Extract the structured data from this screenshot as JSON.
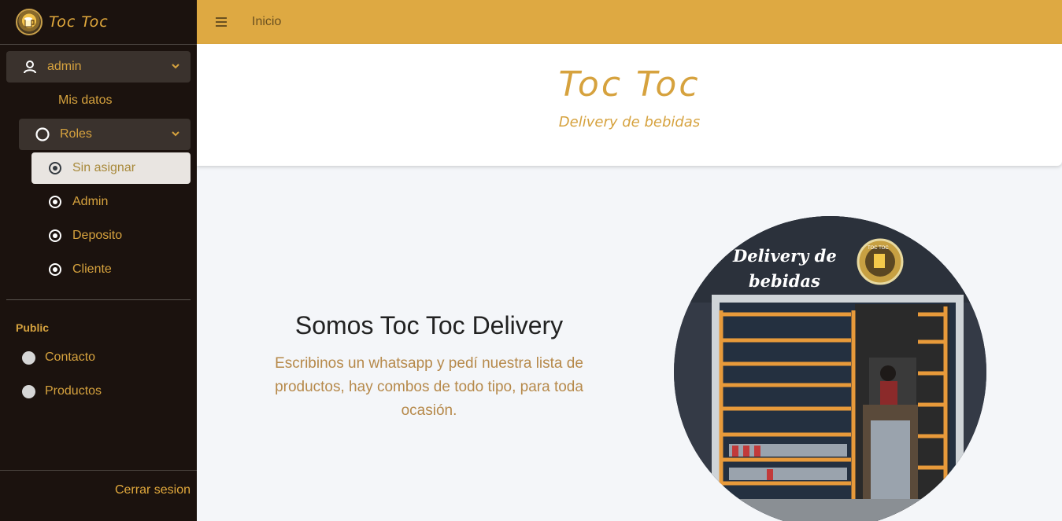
{
  "brand": {
    "name": "Toc Toc"
  },
  "user_menu": {
    "username": "admin",
    "items": [
      {
        "label": "Mis datos"
      }
    ]
  },
  "roles": {
    "label": "Roles",
    "items": [
      {
        "label": "Sin asignar",
        "active": true
      },
      {
        "label": "Admin"
      },
      {
        "label": "Deposito"
      },
      {
        "label": "Cliente"
      }
    ]
  },
  "public": {
    "header": "Public",
    "items": [
      {
        "label": "Contacto"
      },
      {
        "label": "Productos"
      }
    ]
  },
  "footer": {
    "logout_label": "Cerrar sesion"
  },
  "topbar": {
    "link": "Inicio"
  },
  "hero": {
    "title": "Toc Toc",
    "subtitle": "Delivery de bebidas"
  },
  "about": {
    "title": "Somos Toc Toc Delivery",
    "text": "Escribinos un whatsapp y pedí nuestra lista de productos, hay combos de todo tipo, para toda ocasión."
  },
  "storefront": {
    "sign_line1": "Delivery de",
    "sign_line2": "bebidas",
    "logo_text": "TOC TOC"
  },
  "colors": {
    "accent": "#dea942",
    "sidebar_bg": "#1b120e",
    "text_gold": "#d6a23e"
  }
}
